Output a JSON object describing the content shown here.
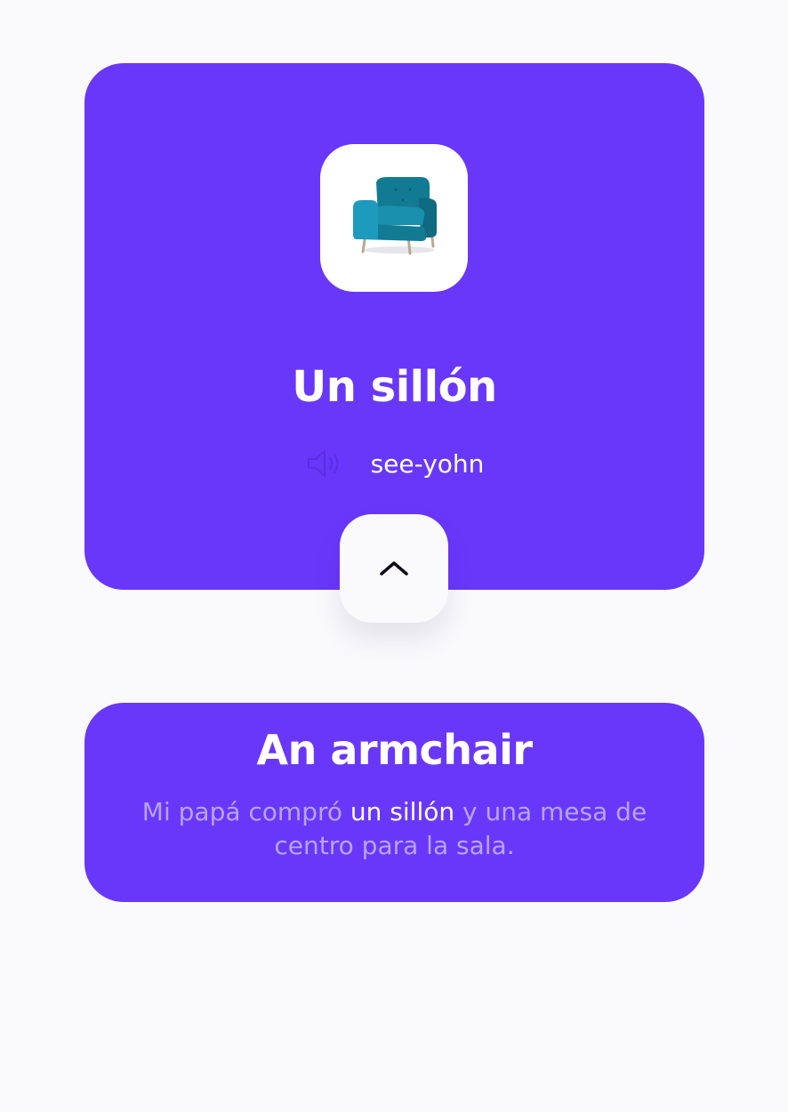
{
  "card": {
    "image_icon": "armchair-icon",
    "word": "Un sillón",
    "speaker_icon": "speaker-icon",
    "pronunciation": "see-yohn",
    "toggle_icon": "chevron-up-icon"
  },
  "answer": {
    "translation": "An armchair",
    "example_before": "Mi papá compró ",
    "example_highlight": "un sillón",
    "example_after": " y una mesa de centro para la sala."
  },
  "colors": {
    "card_bg": "#6937fa",
    "page_bg": "#fafafc",
    "muted_text": "#b8a4fb",
    "highlight_text": "#ffffff"
  }
}
